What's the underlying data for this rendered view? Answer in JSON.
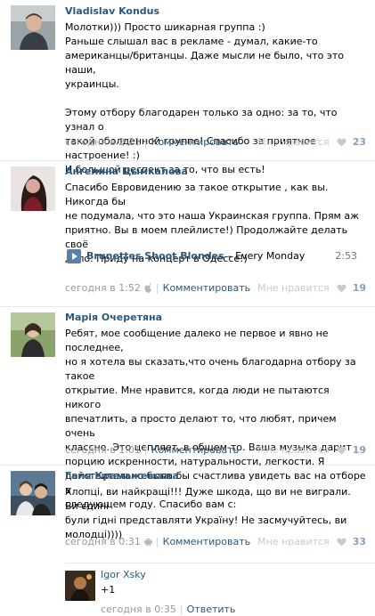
{
  "comments": [
    {
      "author": "Vladislav Kondus",
      "text": "Молотки))) Просто шикарная группа :)\nРаньше слышал вас в рекламе - думал, какие-то\nамериканцы/британцы. Даже мысли не было, что это наши,\nукраинцы.\n\nЭтому отбору благодарен только за одно: за то, что узнал о\nтакой оболденной группе! Спасибо за приятное настроение! :)\nИ большой респект за то, что вы есть!",
      "date": "сегодня в 2:21",
      "reply": "Комментировать",
      "like_label": "Мне нравится",
      "likes": "23"
    },
    {
      "author": "Ангелина Цымкалова",
      "text": "Спасибо Евровидению за такое открытие , как вы. Никогда бы\nне подумала, что это наша Украинская группа. Прям аж\nприятно. Вы в моем плейлисте!) Продолжайте делать своё\nдело. Приду на концерт в Одессе!)",
      "audio": {
        "artist": "Brunettes Shoot Blondes",
        "title": " – Every Monday",
        "duration": "2:53"
      },
      "date": "сегодня в 1:52",
      "platform_icon": "apple-icon",
      "reply": "Комментировать",
      "like_label": "Мне нравится",
      "likes": "19"
    },
    {
      "author": "Марія Очеретяна",
      "text": "Ребят, мое сообщение далеко не первое и явно не последнее,\nно я хотела вы сказать,что очень благодарна отбору за такое\nоткрытие. Мне нравится, когда люди не пытаются никого\nвпечатлить, а просто делают то, что любят, причем очень\nклассно. Это цепляет, в общем-то. Ваша музыка дарит\nпорцию искренности, натуральности, легкости. Я\nдействительно была бы счастлива увидеть вас на отборе в\nследующем году. Спасибо вам с:",
      "date": "сегодня в 1:01",
      "reply": "Комментировать",
      "like_label": "Мне нравится",
      "likes": "19"
    },
    {
      "author": "Галя Крамажевська",
      "text": "Хлопці, ви найкращі!!! Дуже шкода, що ви не виграли. Ви єдині\nбули гідні представляти Україну! Не засмучуйтесь, ви\nмолодці))))",
      "date": "сегодня в 0:31",
      "platform_icon": "android-icon",
      "reply": "Комментировать",
      "like_label": "Мне нравится",
      "likes": "33"
    }
  ],
  "reply_comment": {
    "author": "Igor Xsky",
    "text": "+1",
    "date": "сегодня в 0:35",
    "reply": "Ответить"
  },
  "colors": {
    "link": "#2b587a",
    "muted": "#999999",
    "like_count": "#88a0b8",
    "divider": "#e7eaed"
  }
}
